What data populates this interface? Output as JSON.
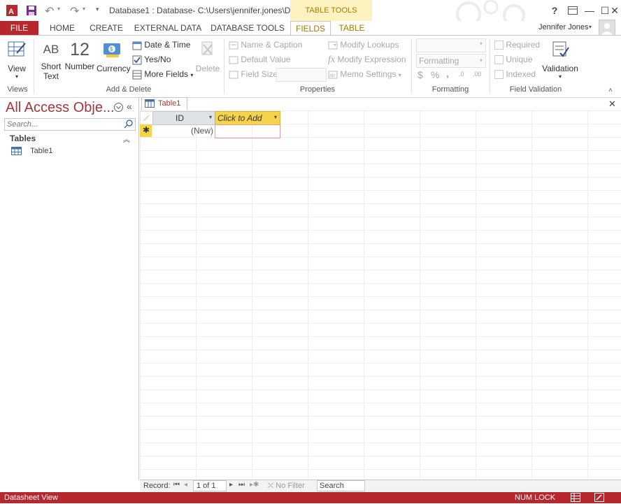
{
  "window": {
    "title": "Database1 : Database- C:\\Users\\jennifer.jones\\D...",
    "context_tools": "TABLE TOOLS",
    "help": "?",
    "minimize": "—",
    "restore": "☐",
    "close": "✕"
  },
  "tabs": {
    "file": "FILE",
    "home": "HOME",
    "create": "CREATE",
    "external_data": "EXTERNAL DATA",
    "database_tools": "DATABASE TOOLS",
    "fields": "FIELDS",
    "table": "TABLE"
  },
  "user": {
    "name": "Jennifer Jones"
  },
  "ribbon": {
    "views": {
      "view": "View",
      "label": "Views"
    },
    "add_delete": {
      "short_text_glyph": "AB",
      "short_text_line1": "Short",
      "short_text_line2": "Text",
      "number_glyph": "12",
      "number": "Number",
      "currency": "Currency",
      "date_time": "Date & Time",
      "yes_no": "Yes/No",
      "more_fields": "More Fields",
      "delete": "Delete",
      "label": "Add & Delete"
    },
    "properties": {
      "name_caption": "Name & Caption",
      "default_value": "Default Value",
      "field_size": "Field Size",
      "modify_lookups": "Modify Lookups",
      "modify_expression": "Modify Expression",
      "memo_settings": "Memo Settings",
      "label": "Properties"
    },
    "formatting": {
      "format_value": "Formatting",
      "dollar": "$",
      "percent": "%",
      "comma": ",",
      "inc_dec": ".0",
      "dec_dec": ".00",
      "label": "Formatting"
    },
    "field_validation": {
      "required": "Required",
      "unique": "Unique",
      "indexed": "Indexed",
      "validation": "Validation",
      "label": "Field Validation"
    }
  },
  "nav_pane": {
    "title": "All Access Obje...",
    "search_placeholder": "Search...",
    "group": "Tables",
    "items": [
      {
        "label": "Table1"
      }
    ]
  },
  "document": {
    "tab_label": "Table1",
    "columns": [
      {
        "label": "ID"
      },
      {
        "label": "Click to Add"
      }
    ],
    "new_row_id": "(New)"
  },
  "record_nav": {
    "record_label": "Record:",
    "position": "1 of 1",
    "filter": "No Filter",
    "search": "Search"
  },
  "status": {
    "view": "Datasheet View",
    "num_lock": "NUM LOCK"
  },
  "colors": {
    "access_red": "#b7282e",
    "context_gold": "#a07c00",
    "header_gold": "#f5d44b"
  }
}
